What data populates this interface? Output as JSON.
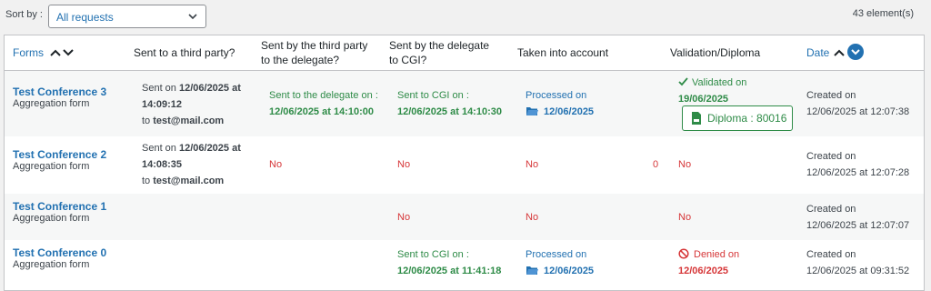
{
  "toolbar": {
    "sort_label": "Sort by :",
    "sort_value": "All requests",
    "count": "43 element(s)"
  },
  "columns": {
    "forms": "Forms",
    "sent_third_party": "Sent to a third party?",
    "sent_by_third_line1": "Sent by the third party",
    "sent_by_third_line2": "to the delegate?",
    "sent_by_delegate_line1": "Sent by the delegate",
    "sent_by_delegate_line2": "to CGI?",
    "taken_into_account": "Taken into account",
    "validation": "Validation/Diploma",
    "date": "Date"
  },
  "rows": [
    {
      "title": "Test Conference 3",
      "subtitle": "Aggregation form",
      "third_party_prefix": "Sent on ",
      "third_party_date": "12/06/2025 at",
      "third_party_time": "14:09:12",
      "third_party_to_prefix": "to ",
      "third_party_email": "test@mail.com",
      "by_third_label": "Sent to the delegate on :",
      "by_third_value": "12/06/2025 at 14:10:00",
      "by_delegate_label": "Sent to CGI on :",
      "by_delegate_value": "12/06/2025 at 14:10:30",
      "taken_label": "Processed on",
      "taken_value": "12/06/2025",
      "validation_label": "Validated on",
      "validation_value": "19/06/2025",
      "diploma": "Diploma : 80016",
      "created_label": "Created on",
      "created_value": "12/06/2025 at 12:07:38"
    },
    {
      "title": "Test Conference 2",
      "subtitle": "Aggregation form",
      "third_party_prefix": "Sent on ",
      "third_party_date": "12/06/2025 at",
      "third_party_time": "14:08:35",
      "third_party_to_prefix": "to ",
      "third_party_email": "test@mail.com",
      "by_third": "No",
      "by_delegate": "No",
      "taken": "No",
      "taken_count": "0",
      "validation": "No",
      "created_label": "Created on",
      "created_value": "12/06/2025 at 12:07:28"
    },
    {
      "title": "Test Conference 1",
      "subtitle": "Aggregation form",
      "by_delegate": "No",
      "taken": "No",
      "validation": "No",
      "created_label": "Created on",
      "created_value": "12/06/2025 at 12:07:07"
    },
    {
      "title": "Test Conference 0",
      "subtitle": "Aggregation form",
      "by_delegate_label": "Sent to CGI on :",
      "by_delegate_value": "12/06/2025 at 11:41:18",
      "taken_label": "Processed on",
      "taken_value": "12/06/2025",
      "validation_label": "Denied on",
      "validation_value": "12/06/2025",
      "created_label": "Created on",
      "created_value": "12/06/2025 at 09:31:52"
    }
  ],
  "colors": {
    "link": "#2271b1",
    "success": "#2e8b47",
    "error": "#d63638",
    "text": "#3c434a"
  },
  "icons": [
    "chevron-down-icon",
    "sort-up-icon",
    "sort-down-icon",
    "circle-chevron-down-icon",
    "check-icon",
    "pdf-icon",
    "folder-icon",
    "deny-icon"
  ]
}
